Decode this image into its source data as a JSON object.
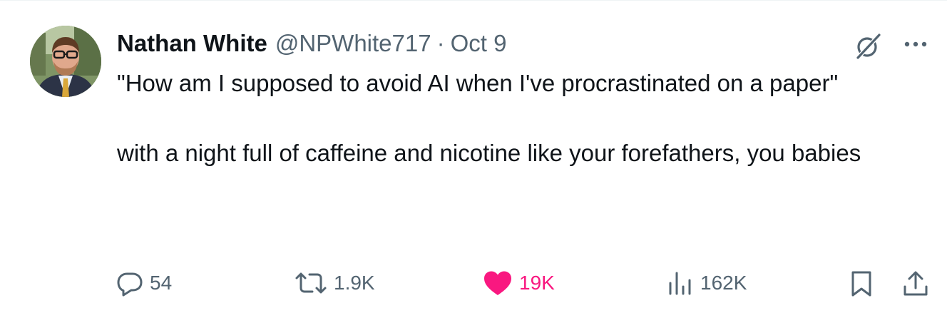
{
  "author": {
    "name": "Nathan White",
    "handle": "@NPWhite717",
    "separator": "·",
    "date": "Oct 9"
  },
  "tweet": {
    "paragraph_1": "\"How am I supposed to avoid AI when I've procrastinated on a paper\"",
    "paragraph_2": "with a night full of caffeine and nicotine like your forefathers, you babies"
  },
  "stats": {
    "replies": "54",
    "reposts": "1.9K",
    "likes": "19K",
    "views": "162K"
  },
  "colors": {
    "text_primary": "#0f1419",
    "text_secondary": "#536471",
    "like_active": "#f91880"
  },
  "icons": {
    "grok": "grok-icon",
    "more": "more-icon",
    "reply": "reply-icon",
    "repost": "repost-icon",
    "like": "heart-icon",
    "views": "views-icon",
    "bookmark": "bookmark-icon",
    "share": "share-icon"
  }
}
